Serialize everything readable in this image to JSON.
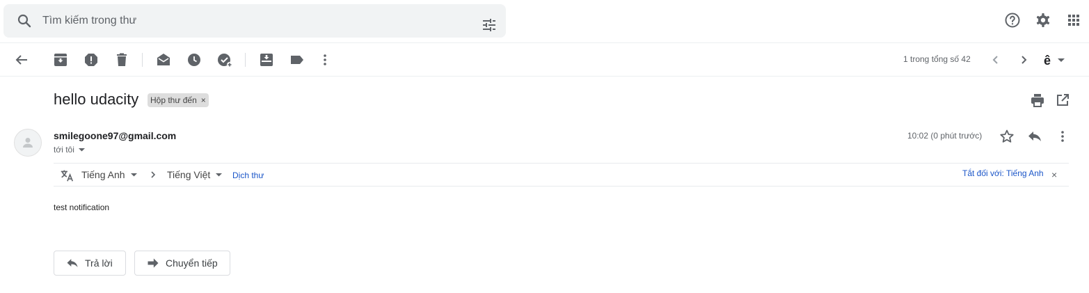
{
  "search": {
    "placeholder": "Tìm kiếm trong thư"
  },
  "top_icons": [
    "search-icon",
    "tune-icon",
    "help-icon",
    "gear-icon",
    "apps-icon"
  ],
  "toolbar": {
    "icons": [
      "back-arrow-icon",
      "archive-icon",
      "report-spam-icon",
      "delete-icon",
      "mark-unread-icon",
      "snooze-icon",
      "add-task-icon",
      "move-to-icon",
      "label-icon",
      "more-vert-icon"
    ],
    "pager_text": "1 trong tổng số 42",
    "input_tool": "ê"
  },
  "message": {
    "subject": "hello udacity",
    "label": "Hộp thư đến",
    "label_remove": "×",
    "sender": "smilegoone97@gmail.com",
    "to": "tới tôi",
    "time": "10:02 (0 phút trước)",
    "body": "test notification"
  },
  "translate": {
    "from": "Tiếng Anh",
    "to": "Tiếng Việt",
    "translate_link": "Dịch thư",
    "turn_off": "Tắt đối với: Tiếng Anh",
    "close": "×"
  },
  "buttons": {
    "reply": "Trả lời",
    "forward": "Chuyển tiếp"
  },
  "colors": {
    "link": "#1a55c8",
    "icon": "#5f6368",
    "search_bg": "#f1f3f4"
  }
}
